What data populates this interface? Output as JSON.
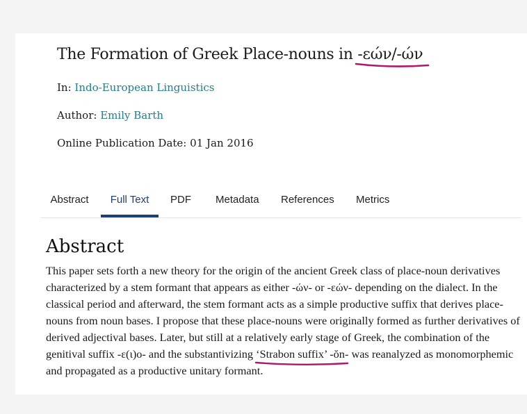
{
  "article": {
    "title_prefix": "The Formation of Greek Place-nouns in",
    "title_greek": "-εών/-ών",
    "in_label": "In:",
    "journal": "Indo-European Linguistics",
    "author_label": "Author:",
    "author": "Emily Barth",
    "pubdate_label": "Online Publication Date:",
    "pubdate": "01 Jan 2016"
  },
  "tabs": {
    "abstract": "Abstract",
    "full_text": "Full Text",
    "pdf": "PDF",
    "metadata": "Metadata",
    "references": "References",
    "metrics": "Metrics",
    "active": "Full Text"
  },
  "abstract": {
    "heading": "Abstract",
    "text_part1": "This paper sets forth a new theory for the origin of the ancient Greek class of place-noun derivatives characterized by a stem formant that appears as either -ών- or -εών- depending on the dialect. In the classical period and afterward, the stem formant acts as a simple productive suffix that derives place-nouns from noun bases. I propose that these place-nouns were originally formed as further derivatives of derived adjectival bases. Later, but still at a relatively early stage of Greek, the combination of the genitival suffix -ε(ι)ο- and the substantivizing",
    "highlight": "‘Strabon suffix’ -ŏn-",
    "text_part2": "was reanalyzed as monomorphemic and propagated as a productive unitary formant."
  },
  "colors": {
    "link": "#1f7f8c",
    "tab_active": "#1d3f73",
    "annotation": "#b0176b"
  }
}
